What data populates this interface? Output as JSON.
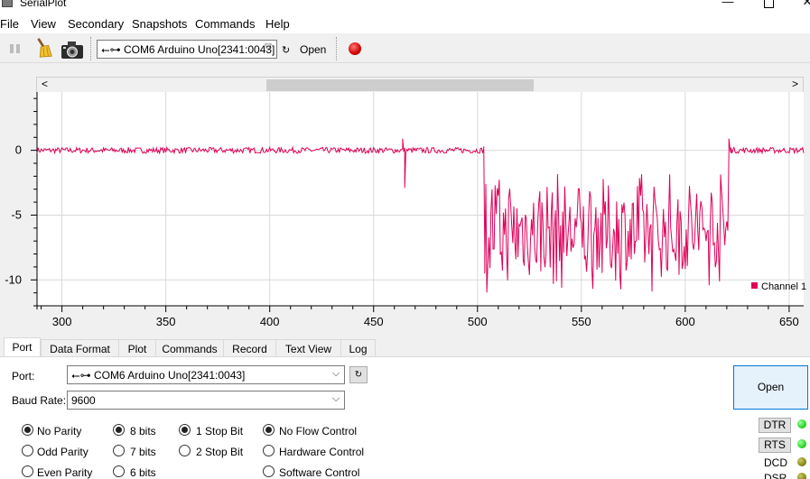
{
  "window": {
    "title": "SerialPlot"
  },
  "menu": [
    "File",
    "View",
    "Secondary",
    "Snapshots",
    "Commands",
    "Help"
  ],
  "toolbar": {
    "port_value": "COM6 Arduino Uno[2341:0043]",
    "open_label": "Open",
    "icons": [
      "pause-icon",
      "clear-broom-icon",
      "snapshot-camera-icon",
      "usb-icon",
      "refresh-icon",
      "record-icon"
    ]
  },
  "plot": {
    "legend_label": "Channel 1",
    "series_color": "#e0005a",
    "scroll_left": "<",
    "scroll_right": ">"
  },
  "chart_data": {
    "type": "line",
    "xlim": [
      288,
      657
    ],
    "ylim": [
      -12,
      4.5
    ],
    "xticks": [
      "300",
      "350",
      "400",
      "450",
      "500",
      "550",
      "600",
      "650"
    ],
    "yticks": [
      "0",
      "-5",
      "-10"
    ],
    "grid": true,
    "series": [
      {
        "name": "Channel 1",
        "events": [
          {
            "x": 464,
            "y": 0.9
          },
          {
            "x": 465,
            "y": -2.9
          },
          {
            "x": 503,
            "y": 0.3
          },
          {
            "x": 503.5,
            "y": -9.5
          },
          {
            "x": 621,
            "y": 0.9
          },
          {
            "x": 622,
            "y": 0.2
          }
        ],
        "flat_level": 0.0,
        "noisy_range": [
          503,
          621
        ],
        "noisy_min": -11.1,
        "noisy_max": -1.3
      }
    ]
  },
  "tabs": [
    "Port",
    "Data Format",
    "Plot",
    "Commands",
    "Record",
    "Text View",
    "Log"
  ],
  "port_tab": {
    "port_label": "Port:",
    "port_value": "COM6 Arduino Uno[2341:0043]",
    "baud_label": "Baud Rate:",
    "baud_value": "9600",
    "open_label": "Open",
    "parity": [
      "No Parity",
      "Odd Parity",
      "Even Parity"
    ],
    "data_bits": [
      "8 bits",
      "7 bits",
      "6 bits"
    ],
    "stop_bits": [
      "1 Stop Bit",
      "2 Stop Bit"
    ],
    "flow_control": [
      "No Flow Control",
      "Hardware Control",
      "Software Control"
    ],
    "signals": {
      "dtr": "DTR",
      "rts": "RTS",
      "dcd": "DCD",
      "dsr": "DSR"
    }
  }
}
